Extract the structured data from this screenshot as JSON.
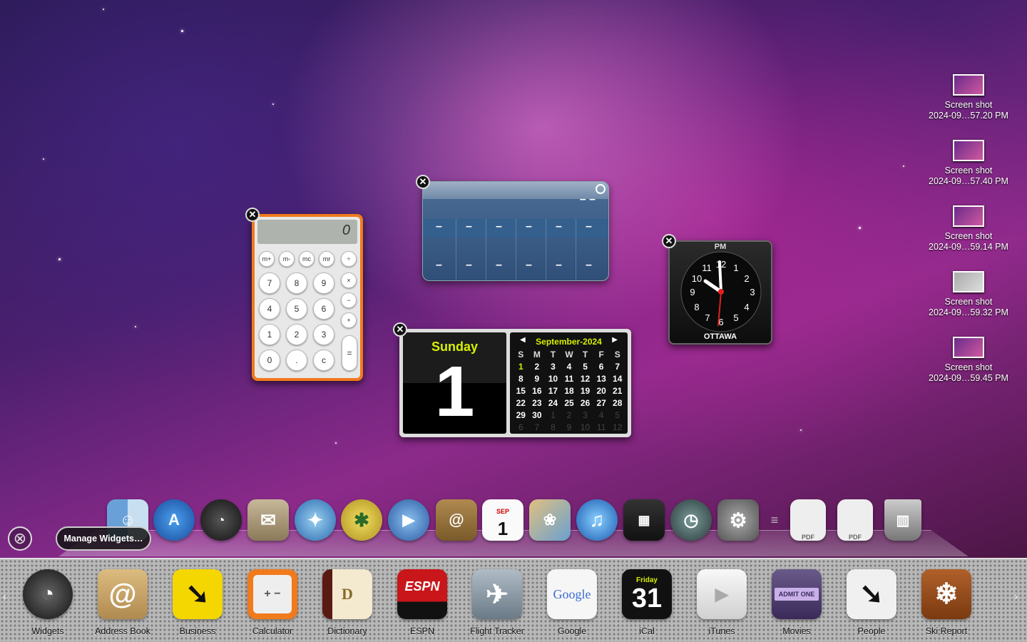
{
  "desktop_files": [
    {
      "name": "Screen shot",
      "date": "2024-09…57.20 PM"
    },
    {
      "name": "Screen shot",
      "date": "2024-09…57.40 PM"
    },
    {
      "name": "Screen shot",
      "date": "2024-09…59.14 PM"
    },
    {
      "name": "Screen shot",
      "date": "2024-09…59.32 PM"
    },
    {
      "name": "Screen shot",
      "date": "2024-09…59.45 PM"
    }
  ],
  "calculator": {
    "display": "0",
    "memory_keys": [
      "m+",
      "m-",
      "mc",
      "mr",
      "÷"
    ],
    "rows": [
      [
        "7",
        "8",
        "9",
        "×"
      ],
      [
        "4",
        "5",
        "6",
        "−"
      ],
      [
        "1",
        "2",
        "3",
        "+"
      ],
      [
        "0",
        ".",
        "c",
        "="
      ]
    ]
  },
  "weather": {
    "top_dash": "– –",
    "dash": "–"
  },
  "clock": {
    "ampm": "PM",
    "city": "OTTAWA",
    "numbers": [
      "12",
      "1",
      "2",
      "3",
      "4",
      "5",
      "6",
      "7",
      "8",
      "9",
      "10",
      "11"
    ]
  },
  "ical": {
    "day_name": "Sunday",
    "day_number": "1",
    "month_header": "September-2024",
    "weekdays": [
      "S",
      "M",
      "T",
      "W",
      "T",
      "F",
      "S"
    ],
    "weeks": [
      [
        "1",
        "2",
        "3",
        "4",
        "5",
        "6",
        "7"
      ],
      [
        "8",
        "9",
        "10",
        "11",
        "12",
        "13",
        "14"
      ],
      [
        "15",
        "16",
        "17",
        "18",
        "19",
        "20",
        "21"
      ],
      [
        "22",
        "23",
        "24",
        "25",
        "26",
        "27",
        "28"
      ],
      [
        "29",
        "30",
        "1",
        "2",
        "3",
        "4",
        "5"
      ],
      [
        "6",
        "7",
        "8",
        "9",
        "10",
        "11",
        "12"
      ]
    ]
  },
  "dashboard_controls": {
    "manage_label": "Manage Widgets…",
    "close_symbol": "⊗"
  },
  "dock_icons": [
    "finder-icon",
    "app-store-icon",
    "dashboard-icon",
    "mail-icon",
    "safari-icon",
    "spider-icon",
    "ichat-icon",
    "address-book-icon",
    "ical-icon",
    "iphoto-icon",
    "itunes-icon",
    "spaces-icon",
    "time-machine-icon",
    "system-preferences-icon",
    "stack-icon",
    "pdf-icon",
    "pdf-icon",
    "trash-icon"
  ],
  "dock_text": {
    "address_at": "@",
    "ical_month": "SEP",
    "ical_day": "1",
    "pdf": "PDF"
  },
  "widget_bar": {
    "items": [
      {
        "label": "Widgets",
        "icon": "widgets-icon",
        "color": "#3a3a3a",
        "glyph": "◔"
      },
      {
        "label": "Address Book",
        "icon": "address-book-icon",
        "color": "#c9a56a",
        "glyph": "@"
      },
      {
        "label": "Business",
        "icon": "business-icon",
        "color": "#f4d600",
        "glyph": "➘"
      },
      {
        "label": "Calculator",
        "icon": "calculator-icon",
        "color": "#f07a1c",
        "glyph": "+ −"
      },
      {
        "label": "Dictionary",
        "icon": "dictionary-icon",
        "color": "#5a1a14",
        "glyph": "D"
      },
      {
        "label": "ESPN",
        "icon": "espn-icon",
        "color": "#c8161b",
        "glyph": "ESPN"
      },
      {
        "label": "Flight Tracker",
        "icon": "flight-tracker-icon",
        "color": "#8a9aa6",
        "glyph": "✈"
      },
      {
        "label": "Google",
        "icon": "google-icon",
        "color": "#f6f6f6",
        "glyph": "Google"
      },
      {
        "label": "iCal",
        "icon": "ical-icon",
        "color": "#111111",
        "glyph": "31",
        "sub": "Friday"
      },
      {
        "label": "iTunes",
        "icon": "itunes-icon",
        "color": "#e8e8e8",
        "glyph": "▶"
      },
      {
        "label": "Movies",
        "icon": "movies-icon",
        "color": "#5a4a7a",
        "glyph": "ADMIT ONE"
      },
      {
        "label": "People",
        "icon": "people-icon",
        "color": "#f0f0f0",
        "glyph": "➘"
      },
      {
        "label": "Ski Report",
        "icon": "ski-report-icon",
        "color": "#9a4a1a",
        "glyph": "❄"
      }
    ]
  },
  "colors": {
    "calc_orange": "#f07a1c",
    "ical_accent": "#d8f000"
  }
}
